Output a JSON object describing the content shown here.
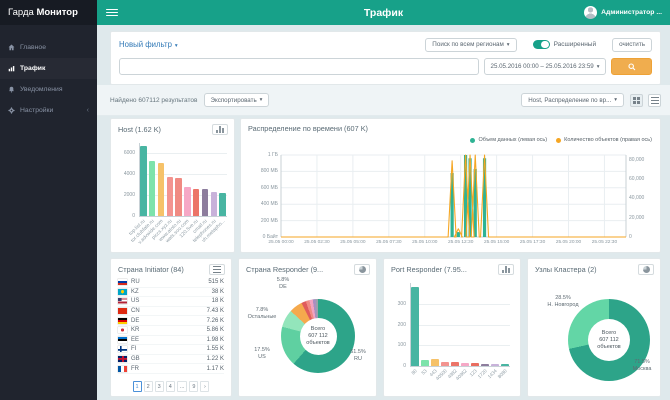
{
  "brand": {
    "name_regular": "Гарда",
    "name_bold": "Монитор"
  },
  "header": {
    "title": "Трафик",
    "user": "Администратор ..."
  },
  "sidebar": {
    "items": [
      {
        "label": "Главное",
        "icon": "home-icon",
        "active": false
      },
      {
        "label": "Трафик",
        "icon": "traffic-icon",
        "active": true
      },
      {
        "label": "Уведомления",
        "icon": "bell-icon",
        "active": false
      },
      {
        "label": "Настройки",
        "icon": "gear-icon",
        "active": false,
        "collapsed": true
      }
    ]
  },
  "filter": {
    "new_filter": "Новый фильтр",
    "region_select": "Поиск по всем регионам",
    "advanced_label": "Расширенный",
    "advanced_on": true,
    "clear_label": "очистить",
    "query_value": "",
    "date_range": "25.05.2016 00:00 – 25.05.2016 23:59"
  },
  "results_bar": {
    "found": "Найдено 607112 результатов",
    "export_label": "Экспортировать",
    "layout_select": "Host, Распределение по вр..."
  },
  "colors": {
    "accent": "#17a189",
    "search_button": "#f0ad4e",
    "link": "#337ab7",
    "bar_green": "#2fb394",
    "line_orange": "#f5a623"
  },
  "chart_data": [
    {
      "id": "host",
      "type": "bar",
      "title": "Host (1.62 K)",
      "categories": [
        "top.list.ru",
        "tor.clubfate.ru",
        "v.advwide.com",
        "piccs.xyz.ru",
        "www.atoto.ru",
        "wats.soo.com",
        "120.5ve.ru",
        "cmail.ru",
        "telephones.ru",
        "vh.metapho..."
      ],
      "values": [
        6700,
        5300,
        5100,
        3700,
        3600,
        2800,
        2600,
        2600,
        2300,
        2200
      ],
      "colors": [
        "#48b5a2",
        "#7de3ab",
        "#f6c269",
        "#f39490",
        "#f08a82",
        "#f6a8c6",
        "#ec7468",
        "#8d7d9d",
        "#c8b2da",
        "#48b5a2"
      ],
      "yticks": [
        0,
        2000,
        4000,
        6000
      ],
      "ymax": 7000
    },
    {
      "id": "time",
      "type": "bar-line",
      "title": "Распределение по времени (607 K)",
      "legend": [
        {
          "label": "Объем данных (левая ось)",
          "color": "#2fb394"
        },
        {
          "label": "Количество объектов (правая ось)",
          "color": "#f5a623"
        }
      ],
      "left_ticks": [
        "1 ГБ",
        "800 МБ",
        "600 МБ",
        "400 МБ",
        "200 МБ",
        "0 Байт"
      ],
      "right_ticks": [
        {
          "label": "80,000",
          "f": 0.94
        },
        {
          "label": "60,000",
          "f": 0.705
        },
        {
          "label": "40,000",
          "f": 0.47
        },
        {
          "label": "20,000",
          "f": 0.235
        },
        {
          "label": "0",
          "f": 0
        }
      ],
      "x_ticks": [
        "25.05 00:00",
        "25.05 02:30",
        "25.05 05:00",
        "25.05 07:30",
        "25.05 10:00",
        "25.05 12:30",
        "25.05 15:00",
        "25.05 17:30",
        "25.05 20:00",
        "25.05 22:30"
      ],
      "spikes": [
        {
          "x": 0.496,
          "bar": 0.78,
          "line": 0.93
        },
        {
          "x": 0.514,
          "bar": 0.06,
          "line": 0.1
        },
        {
          "x": 0.535,
          "bar": 1.0,
          "line": 1.0
        },
        {
          "x": 0.548,
          "bar": 0.96,
          "line": 1.0
        },
        {
          "x": 0.563,
          "bar": 0.83,
          "line": 1.0
        },
        {
          "x": 0.59,
          "bar": 0.96,
          "line": 1.0
        }
      ]
    },
    {
      "id": "country_initiator",
      "type": "table",
      "title": "Страна Initiator (84)",
      "rows": [
        {
          "cc": "ru",
          "label": "RU",
          "value": "515 K"
        },
        {
          "cc": "kz",
          "label": "KZ",
          "value": "38 K"
        },
        {
          "cc": "us",
          "label": "US",
          "value": "18 K"
        },
        {
          "cc": "cn",
          "label": "CN",
          "value": "7.43 K"
        },
        {
          "cc": "de",
          "label": "DE",
          "value": "7.26 K"
        },
        {
          "cc": "kr",
          "label": "KR",
          "value": "5.86 K"
        },
        {
          "cc": "ee",
          "label": "EE",
          "value": "1.98 K"
        },
        {
          "cc": "fi",
          "label": "FI",
          "value": "1.55 K"
        },
        {
          "cc": "gb",
          "label": "GB",
          "value": "1.22 K"
        },
        {
          "cc": "fr",
          "label": "FR",
          "value": "1.17 K"
        }
      ],
      "pagination": [
        "1",
        "2",
        "3",
        "4",
        "...",
        "9",
        "›"
      ]
    },
    {
      "id": "country_responder",
      "type": "pie",
      "title": "Страна Responder (9...",
      "center": [
        "Всего",
        "607 112",
        "объектов"
      ],
      "slices": [
        {
          "label": "RU",
          "pct": 61.5,
          "color": "#2da489"
        },
        {
          "label": "US",
          "pct": 17.5,
          "color": "#5fd0a1"
        },
        {
          "label": "Остальные",
          "pct": 7.8,
          "color": "#93e5bb"
        },
        {
          "label": "DE",
          "pct": 5.8,
          "color": "#f5a94d"
        },
        {
          "label": "",
          "pct": 2.0,
          "color": "#e05b5b"
        },
        {
          "label": "",
          "pct": 1.6,
          "color": "#ef8b84"
        },
        {
          "label": "",
          "pct": 1.5,
          "color": "#f2a3c1"
        },
        {
          "label": "",
          "pct": 1.3,
          "color": "#a98fc0"
        },
        {
          "label": "",
          "pct": 1.0,
          "color": "#9aa2ab"
        }
      ]
    },
    {
      "id": "port_responder",
      "type": "bar",
      "title": "Port Responder (7.95...",
      "categories": [
        "80",
        "53",
        "443",
        "40500",
        "4982",
        "40962",
        "123",
        "1720",
        "1434",
        "8080"
      ],
      "values": [
        380,
        28,
        33,
        18,
        18,
        14,
        14,
        10,
        8,
        8
      ],
      "colors": [
        "#48b5a2",
        "#7de3ab",
        "#f6c269",
        "#f39490",
        "#ec7468",
        "#f6a8c6",
        "#e96d60",
        "#8d7d9d",
        "#c8b2da",
        "#48b5a2"
      ],
      "yticks": [
        0,
        100,
        200,
        300
      ],
      "ymax": 400
    },
    {
      "id": "cluster_nodes",
      "type": "pie",
      "title": "Узлы Кластера (2)",
      "center": [
        "Всего",
        "607 112",
        "объектов"
      ],
      "slices": [
        {
          "label": "Москва",
          "pct": 71.5,
          "color": "#2da489"
        },
        {
          "label": "Н. Новгород",
          "pct": 28.5,
          "color": "#63d6a6"
        }
      ]
    }
  ]
}
